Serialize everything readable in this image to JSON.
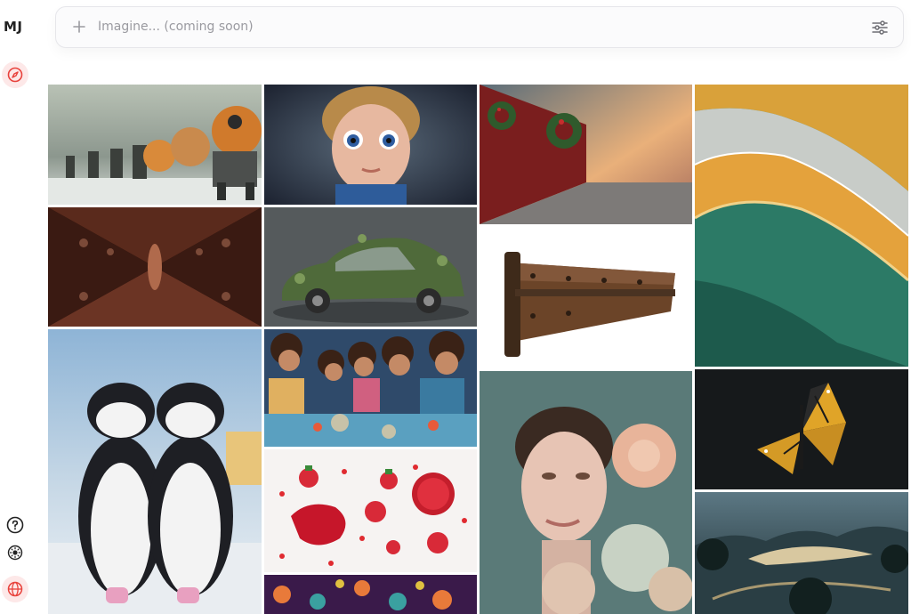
{
  "app": {
    "logo": "MJ"
  },
  "search": {
    "placeholder": "Imagine... (coming soon)"
  },
  "sidebar": {
    "items": [
      {
        "name": "explore",
        "icon": "compass-icon",
        "active": true
      },
      {
        "name": "help",
        "icon": "question-icon"
      },
      {
        "name": "theme",
        "icon": "sun-icon"
      },
      {
        "name": "language",
        "icon": "globe-icon",
        "active": true
      }
    ]
  },
  "colors": {
    "accent": "#e8423c",
    "accent_bg": "#fde8e8"
  },
  "gallery": [
    {
      "subject": "Robots marching in snow"
    },
    {
      "subject": "Curly-haired child with big blue eyes"
    },
    {
      "subject": "Festive train corridor with wreaths"
    },
    {
      "subject": "Teal and gold marbled abstract"
    },
    {
      "subject": "Dark symmetrical tunnel"
    },
    {
      "subject": "Car covered in plants"
    },
    {
      "subject": "Two toy penguins in snow"
    },
    {
      "subject": "Children painting at a table"
    },
    {
      "subject": "Wooden hinge plank"
    },
    {
      "subject": "Strawberries and jam on white"
    },
    {
      "subject": "Portrait with peony flowers"
    },
    {
      "subject": "Yellow butterfly on dark background"
    },
    {
      "subject": "Misty river landscape"
    },
    {
      "subject": "Colorful ornate pattern"
    }
  ]
}
